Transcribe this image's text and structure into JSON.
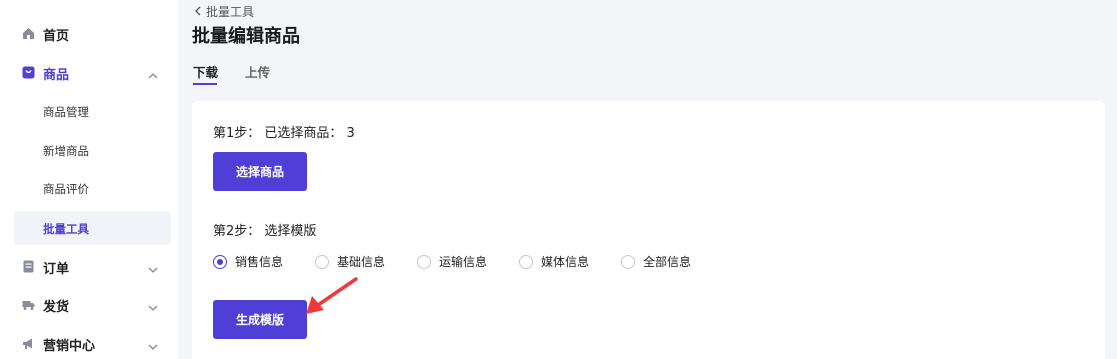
{
  "sidebar": {
    "items": [
      {
        "label": "首页",
        "icon": "home-icon"
      },
      {
        "label": "商品",
        "icon": "bag-icon",
        "expanded": true
      },
      {
        "label": "订单",
        "icon": "order-icon"
      },
      {
        "label": "发货",
        "icon": "truck-icon"
      },
      {
        "label": "营销中心",
        "icon": "megaphone-icon"
      }
    ],
    "sub_items": [
      {
        "label": "商品管理"
      },
      {
        "label": "新增商品"
      },
      {
        "label": "商品评价"
      },
      {
        "label": "批量工具",
        "selected": true
      }
    ]
  },
  "header": {
    "back_label": "批量工具",
    "title": "批量编辑商品",
    "tabs": [
      {
        "label": "下载",
        "active": true
      },
      {
        "label": "上传",
        "active": false
      }
    ]
  },
  "step1": {
    "label": "第1步： 已选择商品： 3",
    "button": "选择商品"
  },
  "step2": {
    "label": "第2步： 选择模版",
    "options": [
      {
        "label": "销售信息",
        "checked": true
      },
      {
        "label": "基础信息",
        "checked": false
      },
      {
        "label": "运输信息",
        "checked": false
      },
      {
        "label": "媒体信息",
        "checked": false
      },
      {
        "label": "全部信息",
        "checked": false
      }
    ],
    "button": "生成模版"
  },
  "colors": {
    "accent": "#4f3fd6",
    "annotation_arrow": "#f0393a",
    "page_bg": "#f4f5f8"
  }
}
